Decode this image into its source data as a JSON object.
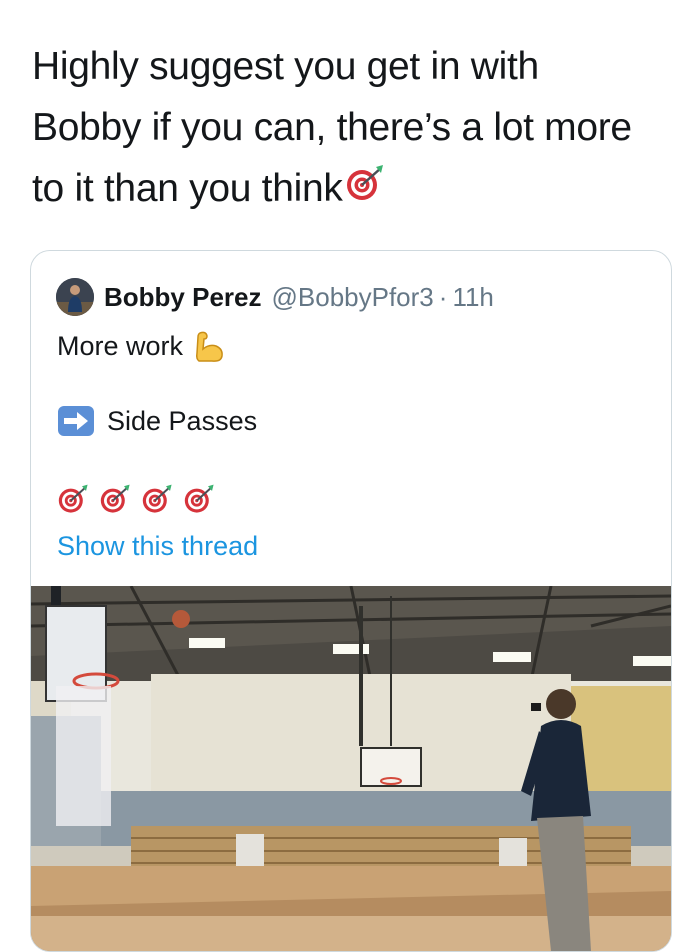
{
  "tweet": {
    "text_lines": [
      "Highly suggest you get in with",
      "Bobby if you can, there’s a lot more",
      "to it than you think"
    ],
    "emoji": "direct-hit-dart-icon"
  },
  "quoted_tweet": {
    "author_name": "Bobby Perez",
    "author_handle": "@BobbyPfor3",
    "separator": "·",
    "time": "11h",
    "line1": "More work",
    "line1_emoji": "flexed-biceps-icon",
    "line2_emoji": "right-arrow-icon",
    "line2": "Side Passes",
    "dart_count": 4,
    "show_thread": "Show this thread",
    "media": "gym-video-thumbnail"
  },
  "colors": {
    "text": "#14171a",
    "secondary": "#657786",
    "link": "#1b95e0",
    "border": "#cfd9de"
  }
}
